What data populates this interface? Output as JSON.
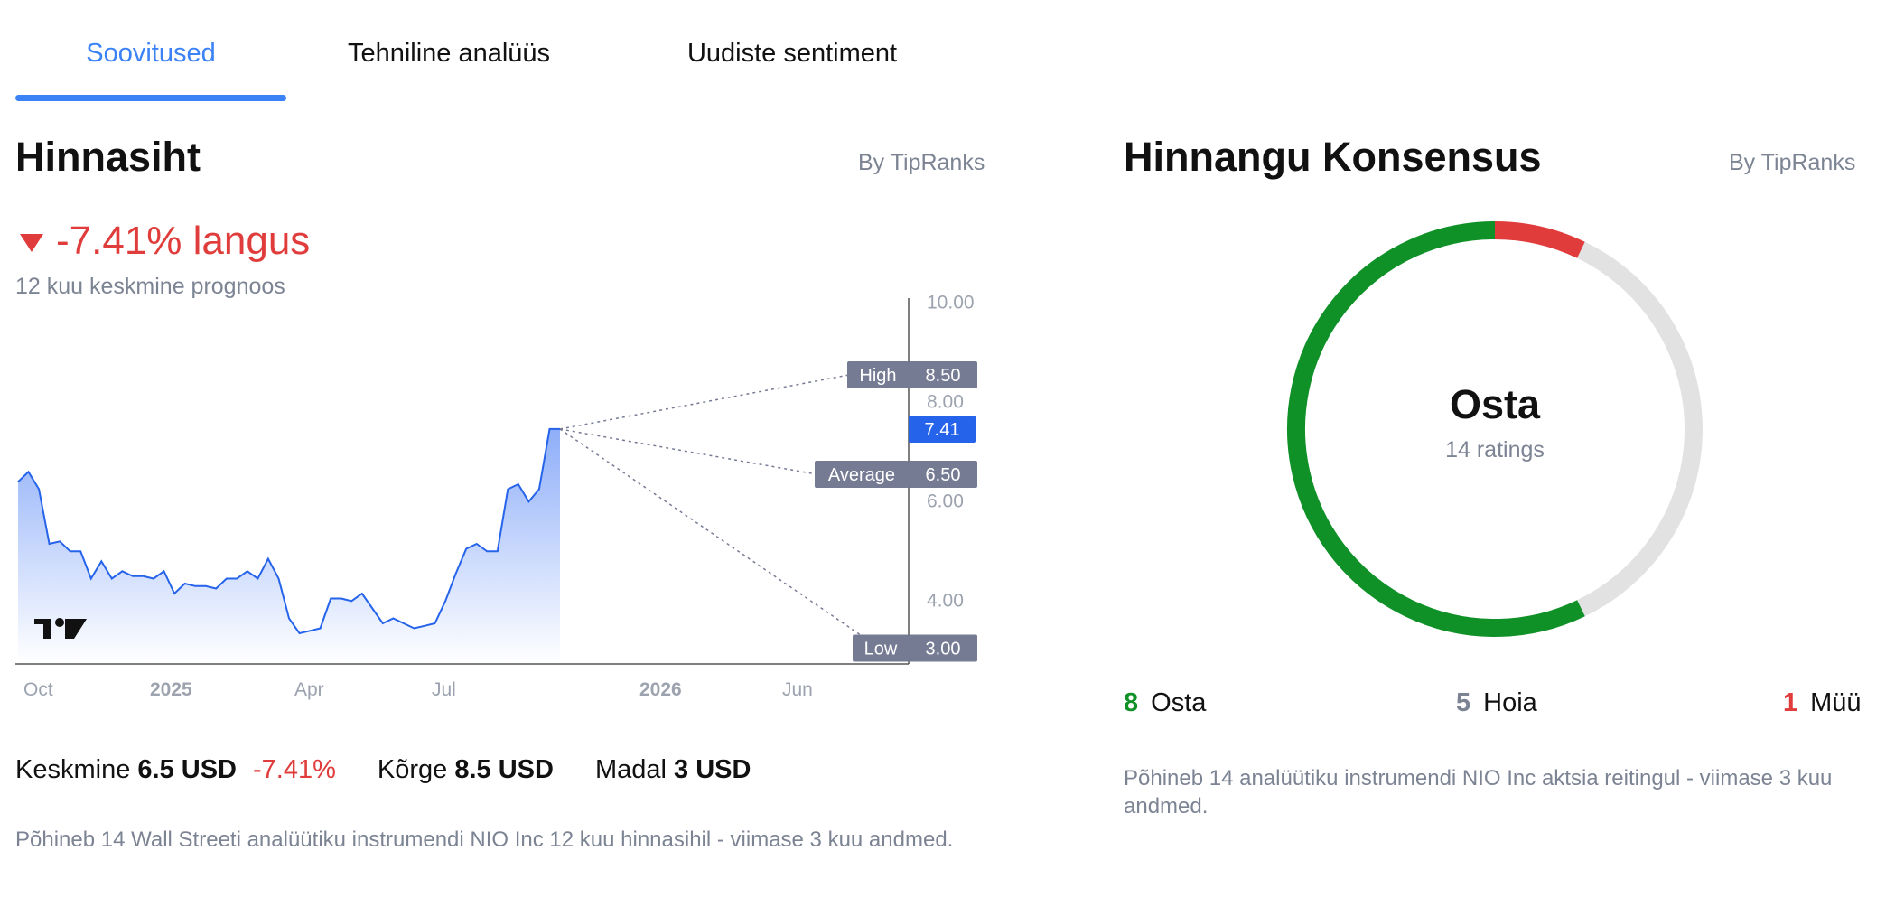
{
  "tabs": [
    {
      "label": "Soovitused",
      "active": true
    },
    {
      "label": "Tehniline analüüs",
      "active": false
    },
    {
      "label": "Uudiste sentiment",
      "active": false
    }
  ],
  "price_target": {
    "title": "Hinnasiht",
    "by": "By TipRanks",
    "change_text": "-7.41% langus",
    "subtitle": "12 kuu keskmine prognoos",
    "summary": {
      "avg_label": "Keskmine",
      "avg_value": "6.5 USD",
      "avg_change": "-7.41%",
      "high_label": "Kõrge",
      "high_value": "8.5 USD",
      "low_label": "Madal",
      "low_value": "3 USD"
    },
    "note": "Põhineb 14 Wall Streeti analüütiku instrumendi NIO Inc 12 kuu hinnasihil - viimase 3 kuu andmed."
  },
  "chart_data": {
    "type": "area",
    "x_ticks": [
      "Oct",
      "2025",
      "Apr",
      "Jul",
      "2026",
      "Jun"
    ],
    "y_ticks": [
      "10.00",
      "8.00",
      "6.00",
      "4.00"
    ],
    "ylim": [
      2.5,
      10.0
    ],
    "price_history": [
      6.35,
      6.55,
      6.2,
      5.1,
      5.15,
      4.95,
      4.95,
      4.4,
      4.75,
      4.4,
      4.55,
      4.45,
      4.45,
      4.4,
      4.55,
      4.1,
      4.3,
      4.25,
      4.25,
      4.2,
      4.4,
      4.4,
      4.55,
      4.4,
      4.8,
      4.4,
      3.6,
      3.3,
      3.35,
      3.4,
      4.0,
      4.0,
      3.95,
      4.1,
      3.8,
      3.5,
      3.6,
      3.5,
      3.4,
      3.45,
      3.5,
      3.95,
      4.5,
      5.0,
      5.1,
      4.95,
      4.95,
      6.2,
      6.3,
      5.95,
      6.2,
      7.41,
      7.41
    ],
    "current": {
      "label": "",
      "value": 7.41,
      "text": "7.41"
    },
    "targets": [
      {
        "label": "High",
        "value": 8.5,
        "text": "8.50"
      },
      {
        "label": "Average",
        "value": 6.5,
        "text": "6.50"
      },
      {
        "label": "Low",
        "value": 3.0,
        "text": "3.00"
      }
    ],
    "colors": {
      "line": "#2563eb",
      "area_top": "#8eaef9",
      "area_bottom": "#ffffff",
      "current_badge": "#2563eb",
      "target_badge": "#767b94"
    }
  },
  "consensus": {
    "title": "Hinnangu Konsensus",
    "by": "By TipRanks",
    "label": "Osta",
    "sub": "14 ratings",
    "buy_count": "8",
    "buy_label": "Osta",
    "hold_count": "5",
    "hold_label": "Hoia",
    "sell_count": "1",
    "sell_label": "Müü",
    "donut": {
      "buy": 8,
      "hold": 5,
      "sell": 1,
      "colors": {
        "buy": "#0f9128",
        "hold": "#e2e2e2",
        "sell": "#e03c3c"
      }
    },
    "note": "Põhineb 14 analüütiku instrumendi NIO Inc aktsia reitingul - viimase 3 kuu andmed."
  }
}
